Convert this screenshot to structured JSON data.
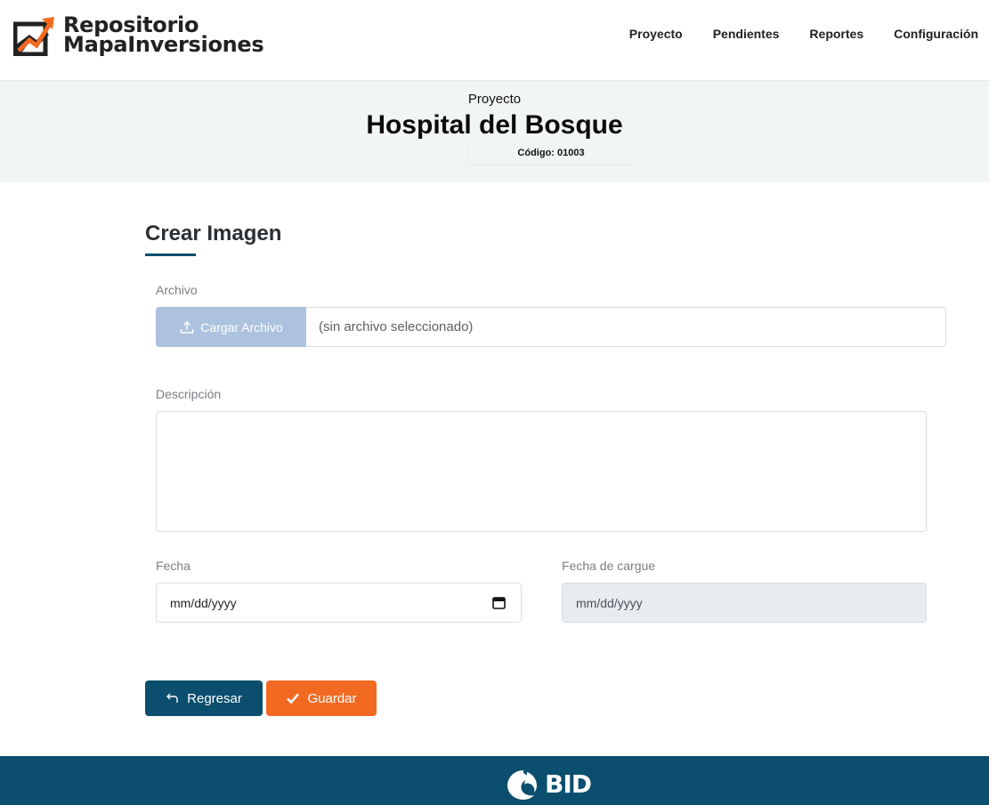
{
  "brand": {
    "line1": "Repositorio",
    "line2": "MapaInversiones",
    "logo_icon": "growth-chart-logo",
    "accent": "#f26a21"
  },
  "nav": {
    "items": [
      {
        "label": "Proyecto"
      },
      {
        "label": "Pendientes"
      },
      {
        "label": "Reportes"
      },
      {
        "label": "Configuración"
      }
    ]
  },
  "project": {
    "kicker": "Proyecto",
    "title": "Hospital del Bosque",
    "code": "Código: 01003"
  },
  "form": {
    "heading": "Crear Imagen",
    "archivo": {
      "label": "Archivo",
      "button": "Cargar Archivo",
      "status": "(sin archivo seleccionado)"
    },
    "descripcion": {
      "label": "Descripción",
      "value": ""
    },
    "fecha": {
      "label": "Fecha",
      "placeholder": "mm/dd/yyyy"
    },
    "fecha_cargue": {
      "label": "Fecha de cargue",
      "placeholder": "mm/dd/yyyy"
    }
  },
  "actions": {
    "back": "Regresar",
    "save": "Guardar",
    "primary_color": "#0b4e6d",
    "save_color": "#f26a21"
  },
  "footer": {
    "logo_text": "BID"
  }
}
